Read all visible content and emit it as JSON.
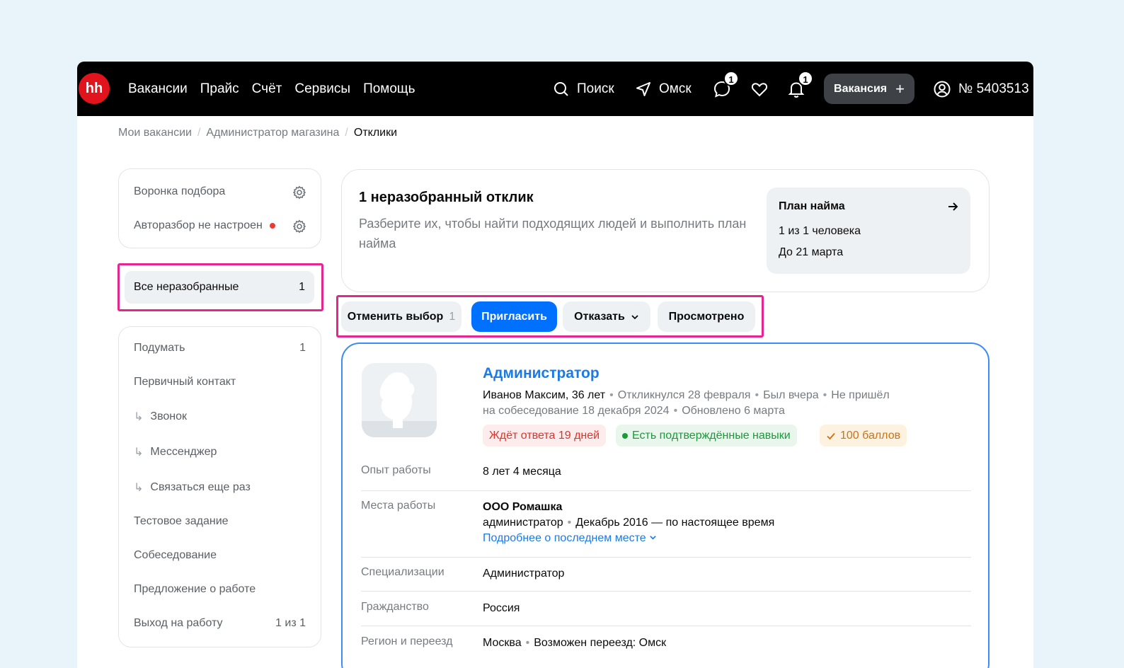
{
  "brand": {
    "logo": "hh",
    "logo_color": "#e1131c"
  },
  "nav": [
    "Вакансии",
    "Прайс",
    "Счёт",
    "Сервисы",
    "Помощь"
  ],
  "top": {
    "search": "Поиск",
    "city": "Омск",
    "chat_count": "1",
    "notif_count": "1",
    "vacancy_btn": "Вакансия",
    "account": "№ 5403513"
  },
  "breadcrumb": {
    "b1": "Мои вакансии",
    "b2": "Администратор магазина",
    "b3": "Отклики",
    "sep": "/"
  },
  "sidebar": {
    "funnel": "Воронка подбора",
    "autosort": "Авторазбор не настроен",
    "all_unsorted": {
      "label": "Все неразобранные",
      "count": "1"
    },
    "stages": [
      {
        "label": "Подумать",
        "count": "1"
      },
      {
        "label": "Первичный контакт",
        "count": ""
      },
      {
        "label": "Звонок",
        "count": ""
      },
      {
        "label": "Мессенджер",
        "count": ""
      },
      {
        "label": "Связаться еще раз",
        "count": ""
      },
      {
        "label": "Тестовое задание",
        "count": ""
      },
      {
        "label": "Собеседование",
        "count": ""
      },
      {
        "label": "Предложение о работе",
        "count": ""
      },
      {
        "label": "Выход на работу",
        "count": "1 из 1"
      }
    ]
  },
  "summary": {
    "title": "1 неразобранный отклик",
    "desc": "Разберите их, чтобы найти подходящих людей и выполнить план найма",
    "plan_title": "План найма",
    "plan_line1": "1 из 1 человека",
    "plan_line2": "До 21 марта"
  },
  "actions": {
    "cancel": "Отменить выбор",
    "cancel_count": "1",
    "invite": "Пригласить",
    "reject": "Отказать",
    "viewed": "Просмотрено"
  },
  "candidate": {
    "title": "Администратор",
    "name_age": "Иванов Максим, 36 лет",
    "responded": "Откликнулся 28 февраля",
    "last_seen": "Был вчера",
    "no_show": "Не пришёл",
    "no_show_2": "на собеседование 18 декабря 2024",
    "updated": "Обновлено 6 марта",
    "tag_wait": "Ждёт ответа 19 дней",
    "tag_skills": "Есть подтверждённые навыки",
    "tag_score": "100 баллов",
    "fields": {
      "exp_label": "Опыт работы",
      "exp_value": "8 лет 4 месяца",
      "work_label": "Места работы",
      "work_company": "ООО Ромашка",
      "work_position": "администратор",
      "work_period": "Декабрь 2016 — по настоящее время",
      "work_more": "Подробнее о последнем месте",
      "spec_label": "Специализации",
      "spec_value": "Администратор",
      "cit_label": "Гражданство",
      "cit_value": "Россия",
      "reg_label": "Регион и переезд",
      "reg_city": "Москва",
      "reg_move": "Возможен переезд: Омск"
    }
  },
  "colors": {
    "accent": "#0070ff",
    "highlight": "#e5268f",
    "link": "#1a7be8"
  }
}
